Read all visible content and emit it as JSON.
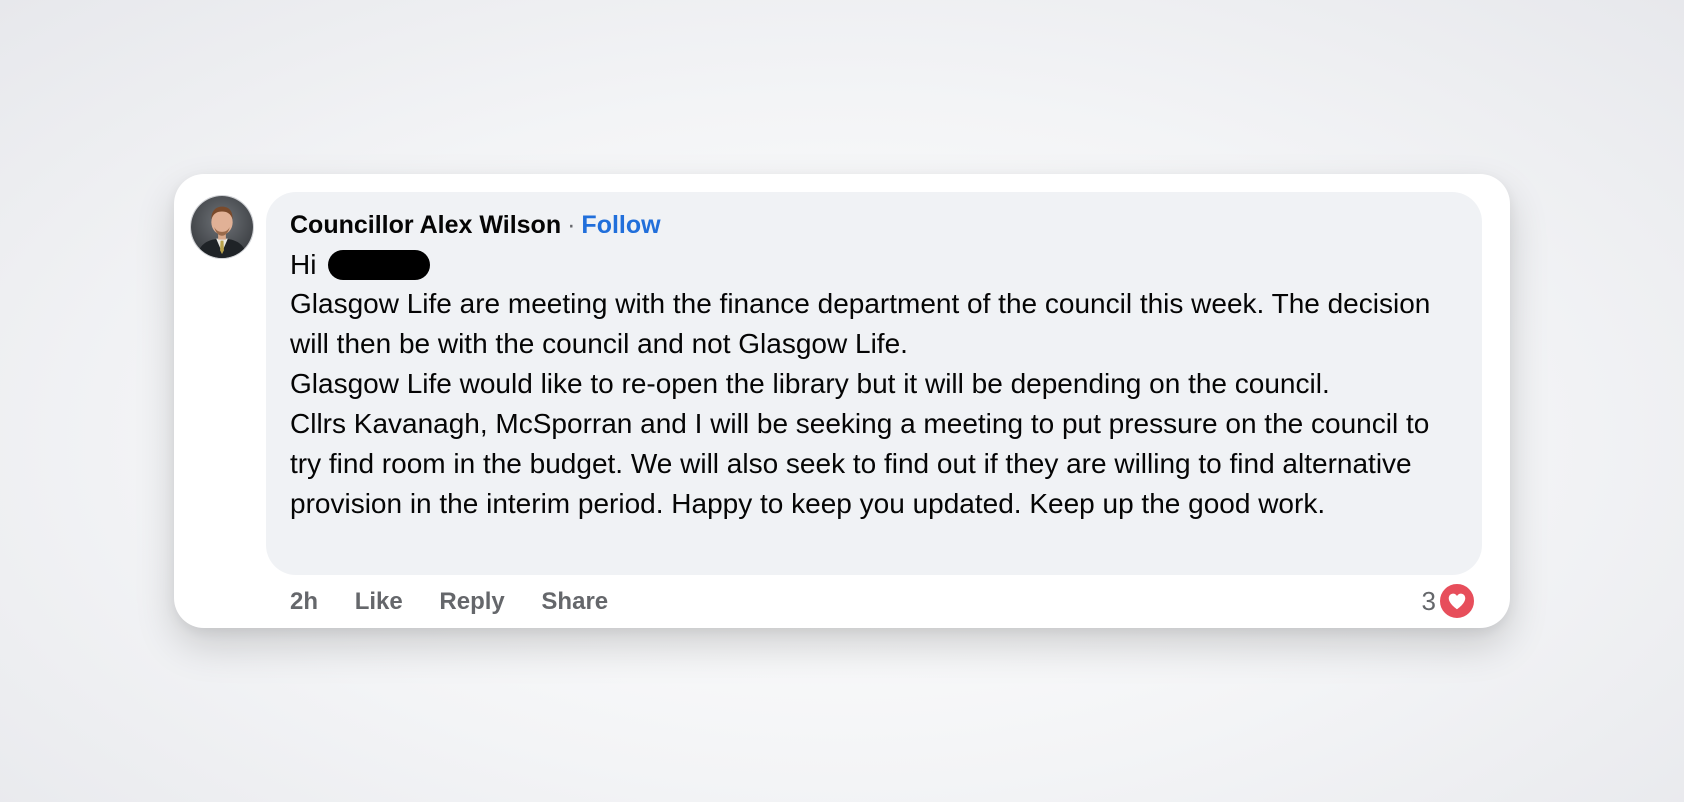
{
  "comment": {
    "author": "Councillor Alex Wilson",
    "separator": "·",
    "follow_label": "Follow",
    "greeting": "Hi",
    "paragraphs": [
      "Glasgow Life are meeting with the finance department of the council this week. The decision will then be with the council and not Glasgow Life.",
      "Glasgow Life would like to re-open the library but it will be depending on the council.",
      "Cllrs Kavanagh, McSporran and I will be seeking a meeting to put pressure on the council to try find room in the budget. We will also seek to find out if they are willing to find alternative provision in the interim period. Happy to keep you updated. Keep up the good work."
    ],
    "timestamp": "2h",
    "actions": {
      "like": "Like",
      "reply": "Reply",
      "share": "Share"
    },
    "reactions": {
      "count": "3",
      "icon": "heart-icon",
      "color": "#e74e5b"
    }
  },
  "colors": {
    "follow_link": "#216fdb",
    "bubble_bg": "#f0f2f5",
    "secondary_text": "#65676b",
    "primary_text": "#050505"
  }
}
